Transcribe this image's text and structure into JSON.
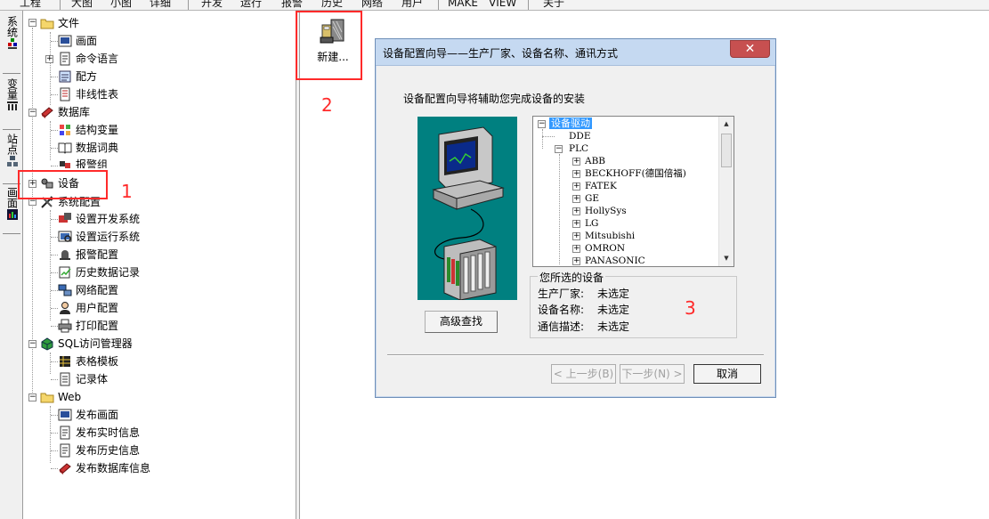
{
  "menubar": {
    "items": [
      "工程",
      "大图",
      "小图",
      "详细",
      "开发",
      "运行",
      "报警",
      "历史",
      "网络",
      "用户",
      "MAKE",
      "VIEW",
      "关于"
    ]
  },
  "vtabs": [
    {
      "label": "系统",
      "icon": "system-icon"
    },
    {
      "label": "变量",
      "icon": "variable-icon"
    },
    {
      "label": "站点",
      "icon": "station-icon"
    },
    {
      "label": "画面",
      "icon": "screen-icon"
    }
  ],
  "tree": {
    "file": {
      "label": "文件",
      "children": [
        "画面",
        "命令语言",
        "配方",
        "非线性表"
      ]
    },
    "database": {
      "label": "数据库",
      "children": [
        "结构变量",
        "数据词典",
        "报警组"
      ]
    },
    "device": {
      "label": "设备"
    },
    "sysconfig": {
      "label": "系统配置",
      "children": [
        "设置开发系统",
        "设置运行系统",
        "报警配置",
        "历史数据记录",
        "网络配置",
        "用户配置",
        "打印配置"
      ]
    },
    "sql": {
      "label": "SQL访问管理器",
      "children": [
        "表格模板",
        "记录体"
      ]
    },
    "web": {
      "label": "Web",
      "children": [
        "发布画面",
        "发布实时信息",
        "发布历史信息",
        "发布数据库信息"
      ]
    }
  },
  "toolbar": {
    "new_label": "新建..."
  },
  "annotations": [
    "1",
    "2",
    "3"
  ],
  "dialog": {
    "title": "设备配置向导——生产厂家、设备名称、通讯方式",
    "close_glyph": "✕",
    "intro": "设备配置向导将辅助您完成设备的安装",
    "advanced_label": "高级查找",
    "device_tree": {
      "root": "设备驱动",
      "dde": "DDE",
      "plc": "PLC",
      "vendors": [
        "ABB",
        "BECKHOFF(德国倍福)",
        "FATEK",
        "GE",
        "HollySys",
        "LG",
        "Mitsubishi",
        "OMRON",
        "PANASONIC"
      ]
    },
    "selection": {
      "title": "您所选的设备",
      "manufacturer_key": "生产厂家:",
      "manufacturer_val": "未选定",
      "name_key": "设备名称:",
      "name_val": "未选定",
      "comm_key": "通信描述:",
      "comm_val": "未选定"
    },
    "buttons": {
      "prev": "< 上一步(B)",
      "next": "下一步(N) >",
      "cancel": "取消"
    }
  },
  "colors": {
    "annotation": "#ff2a2a",
    "illustration_bg": "#008080",
    "selection": "#3399ff"
  }
}
